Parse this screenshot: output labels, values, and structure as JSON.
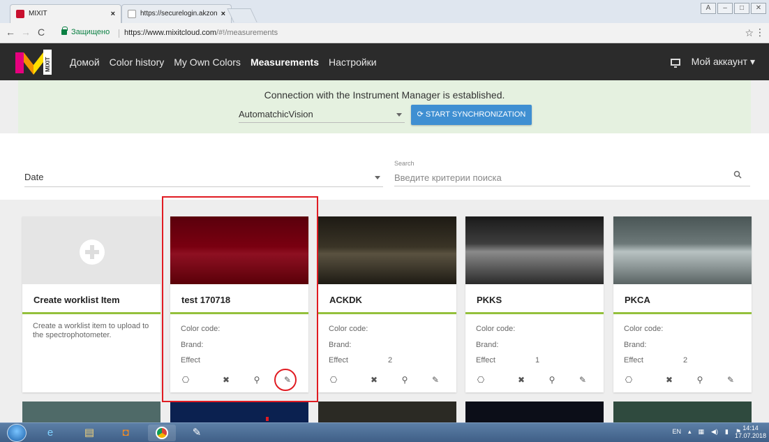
{
  "browser": {
    "tabs": [
      {
        "title": "MIXIT",
        "active": true
      },
      {
        "title": "https://securelogin.akzon",
        "active": false
      }
    ],
    "secure_label": "Защищено",
    "url_host": "https://www.mixitcloud.com",
    "url_path": "/#!/measurements"
  },
  "navbar": {
    "logo_text": "MIXIT",
    "items": [
      "Домой",
      "Color history",
      "My Own Colors",
      "Measurements",
      "Настройки"
    ],
    "active": "Measurements",
    "account_label": "Мой аккаунт"
  },
  "banner": {
    "message": "Connection with the Instrument Manager is established.",
    "instrument": "AutomatchicVision",
    "sync_label": "START SYNCHRONIZATION"
  },
  "filter": {
    "sort_value": "Date",
    "search_label": "Search",
    "search_placeholder": "Введите критерии поиска"
  },
  "cards": [
    {
      "title": "Create worklist Item",
      "description": "Create a worklist item to upload to the spectrophotometer."
    },
    {
      "title": "test 170718",
      "color_code_label": "Color code:",
      "brand_label": "Brand:",
      "effect_label": "Effect",
      "effect_value": "",
      "swatch": "#7a0010"
    },
    {
      "title": "ACKDK",
      "color_code_label": "Color code:",
      "brand_label": "Brand:",
      "effect_label": "Effect",
      "effect_value": "2",
      "swatch": "#3a3426"
    },
    {
      "title": "PKKS",
      "color_code_label": "Color code:",
      "brand_label": "Brand:",
      "effect_label": "Effect",
      "effect_value": "1",
      "swatch": "#4a4a4a"
    },
    {
      "title": "PKCA",
      "color_code_label": "Color code:",
      "brand_label": "Brand:",
      "effect_label": "Effect",
      "effect_value": "2",
      "swatch": "#6c7878"
    }
  ],
  "partial_row_colors": [
    "#4f6a68",
    "#0b2150",
    "#2b2a24",
    "#0c0e18",
    "#2f4a3e"
  ],
  "taskbar": {
    "lang": "EN",
    "time": "14:14",
    "date": "17.07.2018"
  },
  "colors": {
    "accent": "#3f8fd2",
    "card_bar": "#94c03c",
    "annotation": "#e01b22"
  }
}
